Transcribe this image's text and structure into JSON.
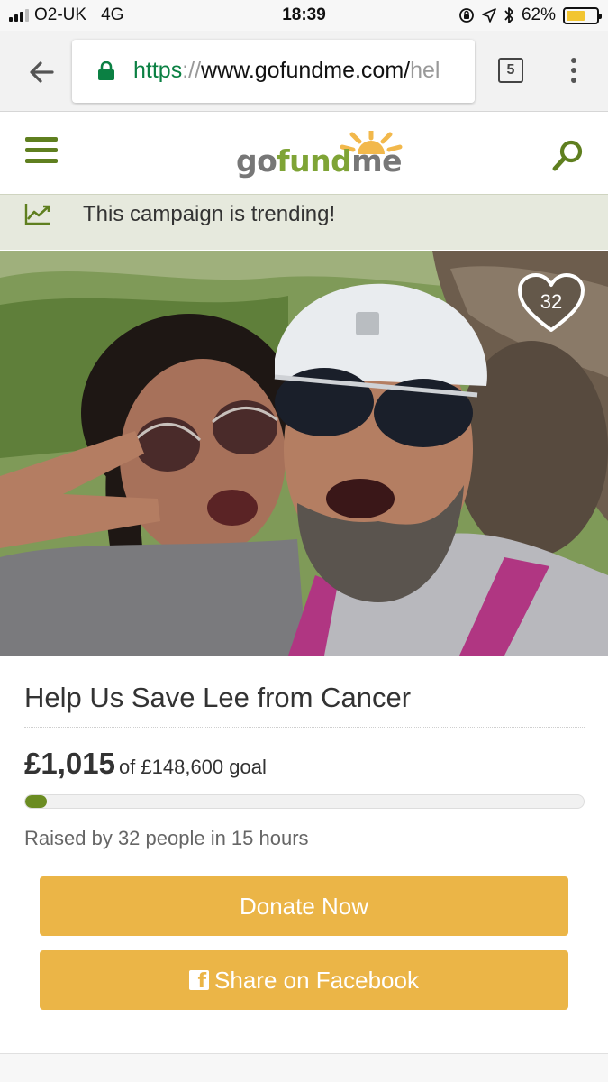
{
  "status_bar": {
    "carrier": "O2-UK",
    "network": "4G",
    "time": "18:39",
    "battery_percent": "62%",
    "battery_level": 0.62
  },
  "browser": {
    "url_scheme": "https",
    "url_separator": "://",
    "url_host": "www.gofundme.com/",
    "url_path_fragment": "hel",
    "tab_count": "5",
    "icons": [
      "back-arrow-icon",
      "lock-icon",
      "tabs-icon",
      "more-vert-icon"
    ]
  },
  "site": {
    "logo_go": "go",
    "logo_fund": "fund",
    "logo_me": "me",
    "icons": [
      "hamburger-menu-icon",
      "search-icon"
    ]
  },
  "trending": {
    "text": "This campaign is trending!",
    "icon": "trending-chart-icon"
  },
  "hero": {
    "heart_count": "32",
    "icon": "heart-icon"
  },
  "campaign": {
    "title": "Help Us Save Lee from Cancer",
    "raised_amount": "£1,015",
    "goal_text": "of £148,600 goal",
    "progress_fraction": 0.0068,
    "meta": "Raised by 32 people in 15 hours"
  },
  "actions": {
    "donate_label": "Donate Now",
    "share_label": "Share on Facebook",
    "share_icon": "facebook-icon"
  },
  "colors": {
    "brand_green": "#6b8c22",
    "button_gold": "#ebb547",
    "trending_bg": "#e6e9dd"
  }
}
